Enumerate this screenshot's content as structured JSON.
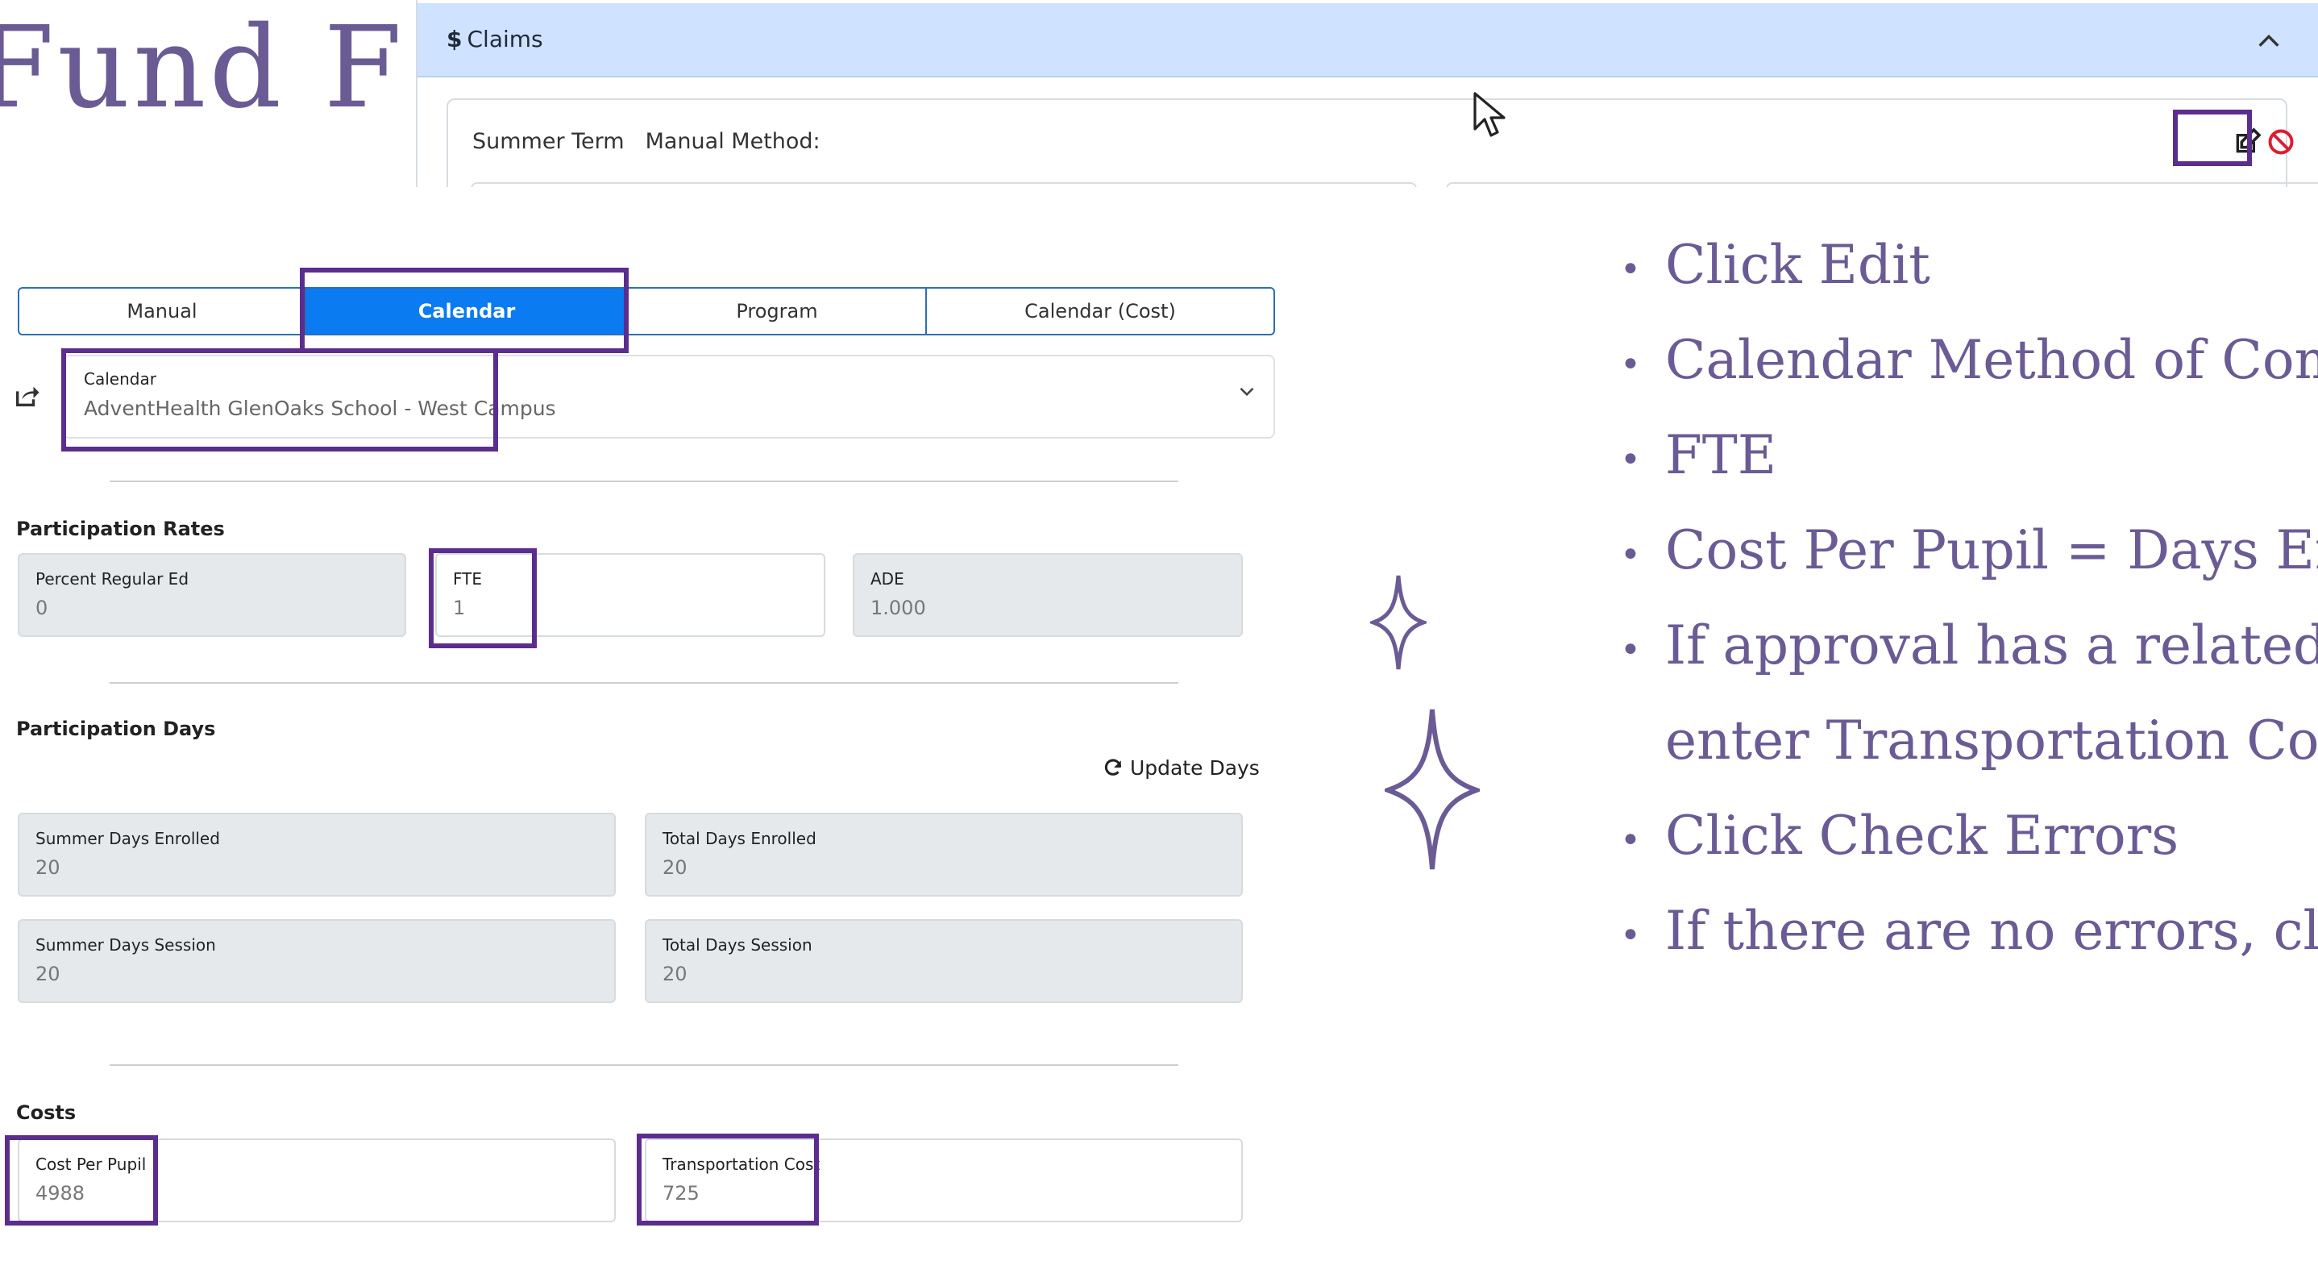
{
  "slide": {
    "title": "Fund F"
  },
  "claims": {
    "header": "Claims",
    "currency_symbol": "$",
    "summer_term_label": "Summer Term",
    "manual_method_label": "Manual Method:"
  },
  "tabs": [
    {
      "label": "Manual"
    },
    {
      "label": "Calendar"
    },
    {
      "label": "Program"
    },
    {
      "label": "Calendar (Cost)"
    }
  ],
  "calendar": {
    "label": "Calendar",
    "value": "AdventHealth GlenOaks School - West Campus"
  },
  "participation_rates": {
    "heading": "Participation Rates",
    "percent_regular_ed": {
      "label": "Percent Regular Ed",
      "value": "0"
    },
    "fte": {
      "label": "FTE",
      "value": "1"
    },
    "ade": {
      "label": "ADE",
      "value": "1.000"
    }
  },
  "participation_days": {
    "heading": "Participation Days",
    "update_days_label": "Update Days",
    "summer_days_enrolled": {
      "label": "Summer Days Enrolled",
      "value": "20"
    },
    "total_days_enrolled": {
      "label": "Total Days Enrolled",
      "value": "20"
    },
    "summer_days_session": {
      "label": "Summer Days Session",
      "value": "20"
    },
    "total_days_session": {
      "label": "Total Days Session",
      "value": "20"
    }
  },
  "costs": {
    "heading": "Costs",
    "cost_per_pupil": {
      "label": "Cost Per Pupil",
      "value": "4988"
    },
    "transportation_cost": {
      "label": "Transportation Cost",
      "value": "725"
    }
  },
  "instructions": [
    "Click Edit",
    "Calendar Method of Com",
    "FTE",
    "Cost Per Pupil = Days Enr",
    "If approval has a related",
    "enter Transportation Cos",
    "Click Check Errors",
    "If there are no errors, clic"
  ],
  "colors": {
    "accent_purple": "#6b5b95",
    "highlight_border": "#5b2d8e",
    "tab_active": "#0a7bf0",
    "claims_header_bg": "#cfe2ff"
  }
}
